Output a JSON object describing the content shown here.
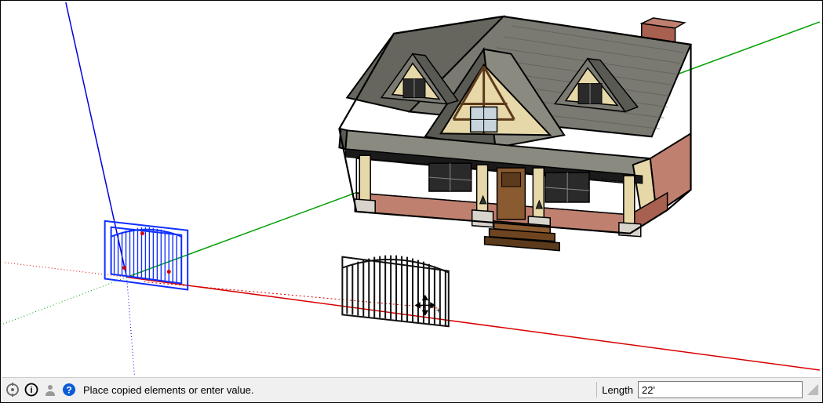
{
  "statusbar": {
    "hint": "Place copied elements or enter value.",
    "measurement_label": "Length",
    "measurement_value": "22'",
    "icons": [
      "geo-location-icon",
      "credits-icon",
      "person-icon",
      "help-icon"
    ]
  },
  "colors": {
    "axis_red": "#d80000",
    "axis_green": "#00a000",
    "axis_blue": "#0000e0",
    "selection_blue": "#1030ff",
    "roof_dark": "#5a5a54",
    "roof_light": "#8a8a80",
    "wall_cream": "#e6d8a8",
    "wall_white": "#ffffff",
    "brick": "#c08070",
    "brick_dark": "#a86050",
    "wood": "#8a5a30",
    "wood_dark": "#5c3a1c",
    "window_dark": "#2a2a2a",
    "trim": "#1a1a1a",
    "porch_stone": "#d8d4cc"
  },
  "scene": {
    "axes": {
      "origin": [
        158,
        352
      ],
      "red_end": [
        1046,
        471
      ],
      "red_neg": [
        0,
        333
      ],
      "green_end": [
        1046,
        25
      ],
      "green_neg": [
        0,
        412
      ],
      "blue_end": [
        80,
        0
      ]
    },
    "objects": [
      "house",
      "fence-original-selected",
      "fence-copy",
      "move-cursor"
    ]
  }
}
